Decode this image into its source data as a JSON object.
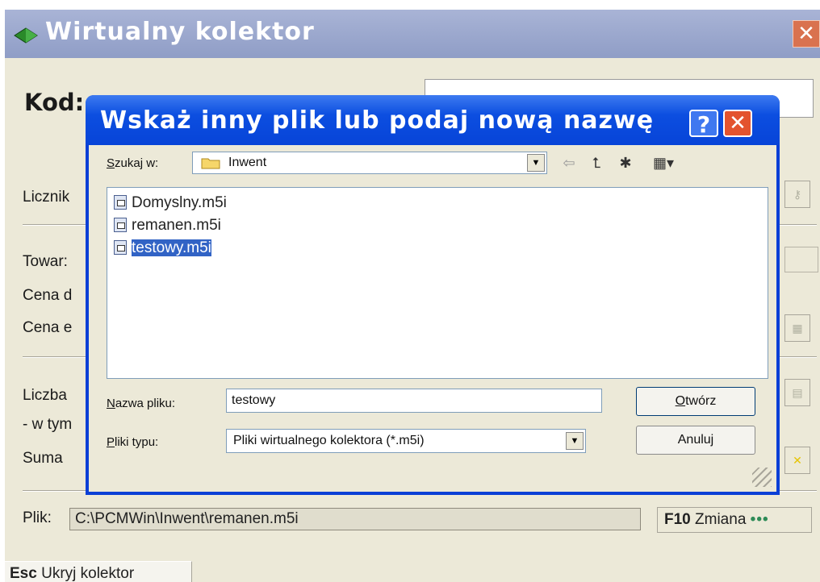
{
  "main": {
    "title": "Wirtualny kolektor",
    "close_glyph": "✕",
    "kod_label": "Kod:",
    "licznik_label": "Licznik",
    "towar_label": "Towar:",
    "cena_d_label": "Cena d",
    "cena_e_label": "Cena e",
    "liczba_label": "Liczba",
    "w_tym_label": "- w tym",
    "suma_label": "Suma",
    "plik_label": "Plik:",
    "plik_value": "C:\\PCMWin\\Inwent\\remanen.m5i",
    "f10_key": "F10",
    "zmiana_label": "Zmiana",
    "zmiana_icon": "•••",
    "esc_key": "Esc",
    "ukryj_label": "Ukryj kolektor"
  },
  "dialog": {
    "title": "Wskaż inny plik lub podaj nową nazwę",
    "help_glyph": "?",
    "close_glyph": "✕",
    "lookin_label_u": "S",
    "lookin_label_rest": "zukaj w:",
    "lookin_value": "Inwent",
    "files": [
      {
        "name": "Domyslny.m5i",
        "selected": false
      },
      {
        "name": "remanen.m5i",
        "selected": false
      },
      {
        "name": "testowy.m5i",
        "selected": true
      }
    ],
    "filename_label_u": "N",
    "filename_label_rest": "azwa pliku:",
    "filename_value": "testowy",
    "filetype_label_u": "P",
    "filetype_label_rest": "liki typu:",
    "filetype_value": "Pliki wirtualnego kolektora (*.m5i)",
    "open_label_u": "O",
    "open_label_rest": "twórz",
    "cancel_label": "Anuluj"
  },
  "colors": {
    "dialog_title_blue": "#0c4ee0",
    "selection_blue": "#3163c5",
    "main_title_bg": "#8f9dc6"
  },
  "icons": [
    "app-icon",
    "folder-icon",
    "back-arrow-icon",
    "up-folder-icon",
    "new-folder-icon",
    "view-menu-icon",
    "file-icon",
    "chevron-down-icon",
    "dots-icon",
    "resize-grip-icon"
  ]
}
